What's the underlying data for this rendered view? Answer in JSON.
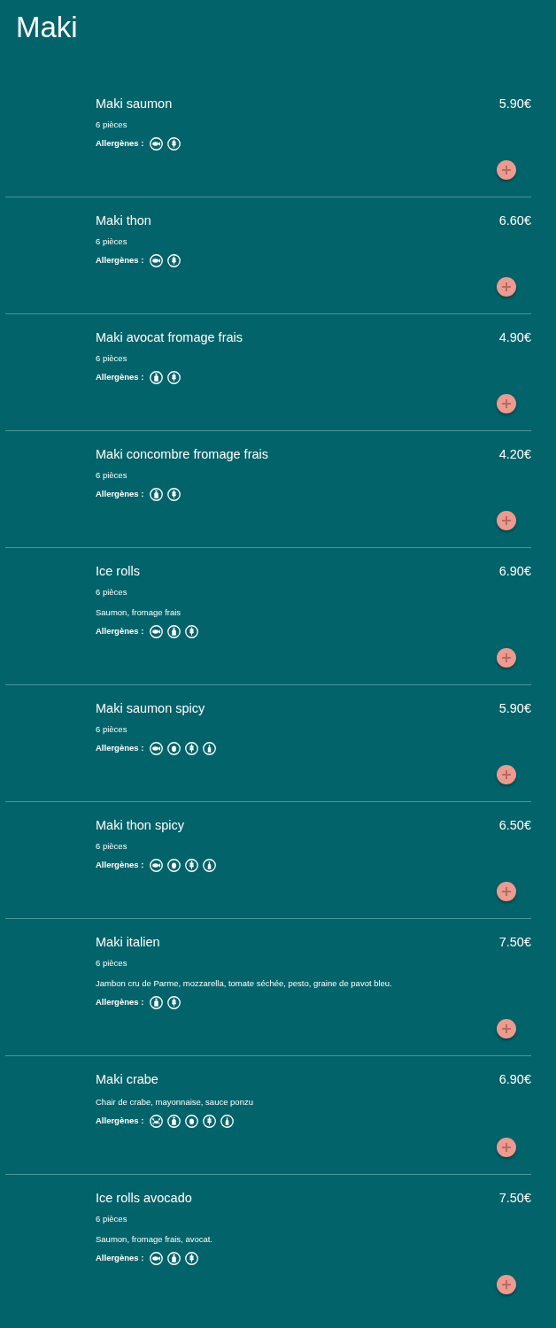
{
  "page": {
    "title": "Maki"
  },
  "items": [
    {
      "name": "Maki saumon",
      "price": "5.90€",
      "pieces": "6 pièces",
      "allergens_label": "Allergènes :",
      "allergens": [
        {
          "kind": "fish"
        },
        {
          "kind": "gluten"
        }
      ]
    },
    {
      "name": "Maki thon",
      "price": "6.60€",
      "pieces": "6 pièces",
      "allergens_label": "Allergènes :",
      "allergens": [
        {
          "kind": "fish"
        },
        {
          "kind": "gluten"
        }
      ]
    },
    {
      "name": "Maki avocat fromage frais",
      "price": "4.90€",
      "pieces": "6 pièces",
      "allergens_label": "Allergènes :",
      "allergens": [
        {
          "kind": "milk"
        },
        {
          "kind": "gluten"
        }
      ]
    },
    {
      "name": "Maki concombre fromage frais",
      "price": "4.20€",
      "pieces": "6 pièces",
      "allergens_label": "Allergènes :",
      "allergens": [
        {
          "kind": "milk"
        },
        {
          "kind": "gluten"
        }
      ]
    },
    {
      "name": "Ice rolls",
      "price": "6.90€",
      "pieces": "6 pièces",
      "description": "Saumon, fromage frais",
      "allergens_label": "Allergènes :",
      "allergens": [
        {
          "kind": "fish"
        },
        {
          "kind": "milk"
        },
        {
          "kind": "gluten"
        }
      ]
    },
    {
      "name": "Maki saumon spicy",
      "price": "5.90€",
      "pieces": "6 pièces",
      "allergens_label": "Allergènes :",
      "allergens": [
        {
          "kind": "fish"
        },
        {
          "kind": "egg"
        },
        {
          "kind": "gluten"
        },
        {
          "kind": "soy"
        }
      ]
    },
    {
      "name": "Maki thon spicy",
      "price": "6.50€",
      "pieces": "6 pièces",
      "allergens_label": "Allergènes :",
      "allergens": [
        {
          "kind": "fish"
        },
        {
          "kind": "egg"
        },
        {
          "kind": "gluten"
        },
        {
          "kind": "soy"
        }
      ]
    },
    {
      "name": "Maki italien",
      "price": "7.50€",
      "pieces": "6 pièces",
      "description": "Jambon cru de Parme, mozzarella, tomate séchée, pesto, graine de pavot bleu.",
      "allergens_label": "Allergènes :",
      "allergens": [
        {
          "kind": "milk"
        },
        {
          "kind": "gluten"
        }
      ]
    },
    {
      "name": "Maki crabe",
      "price": "6.90€",
      "description": "Chair de crabe, mayonnaise, sauce ponzu",
      "allergens_label": "Allergènes :",
      "allergens": [
        {
          "kind": "crustacean"
        },
        {
          "kind": "milk"
        },
        {
          "kind": "egg"
        },
        {
          "kind": "gluten"
        },
        {
          "kind": "soy"
        }
      ]
    },
    {
      "name": "Ice rolls avocado",
      "price": "7.50€",
      "pieces": "6 pièces",
      "description": "Saumon, fromage frais, avocat.",
      "allergens_label": "Allergènes :",
      "allergens": [
        {
          "kind": "fish"
        },
        {
          "kind": "milk"
        },
        {
          "kind": "gluten"
        }
      ]
    }
  ]
}
